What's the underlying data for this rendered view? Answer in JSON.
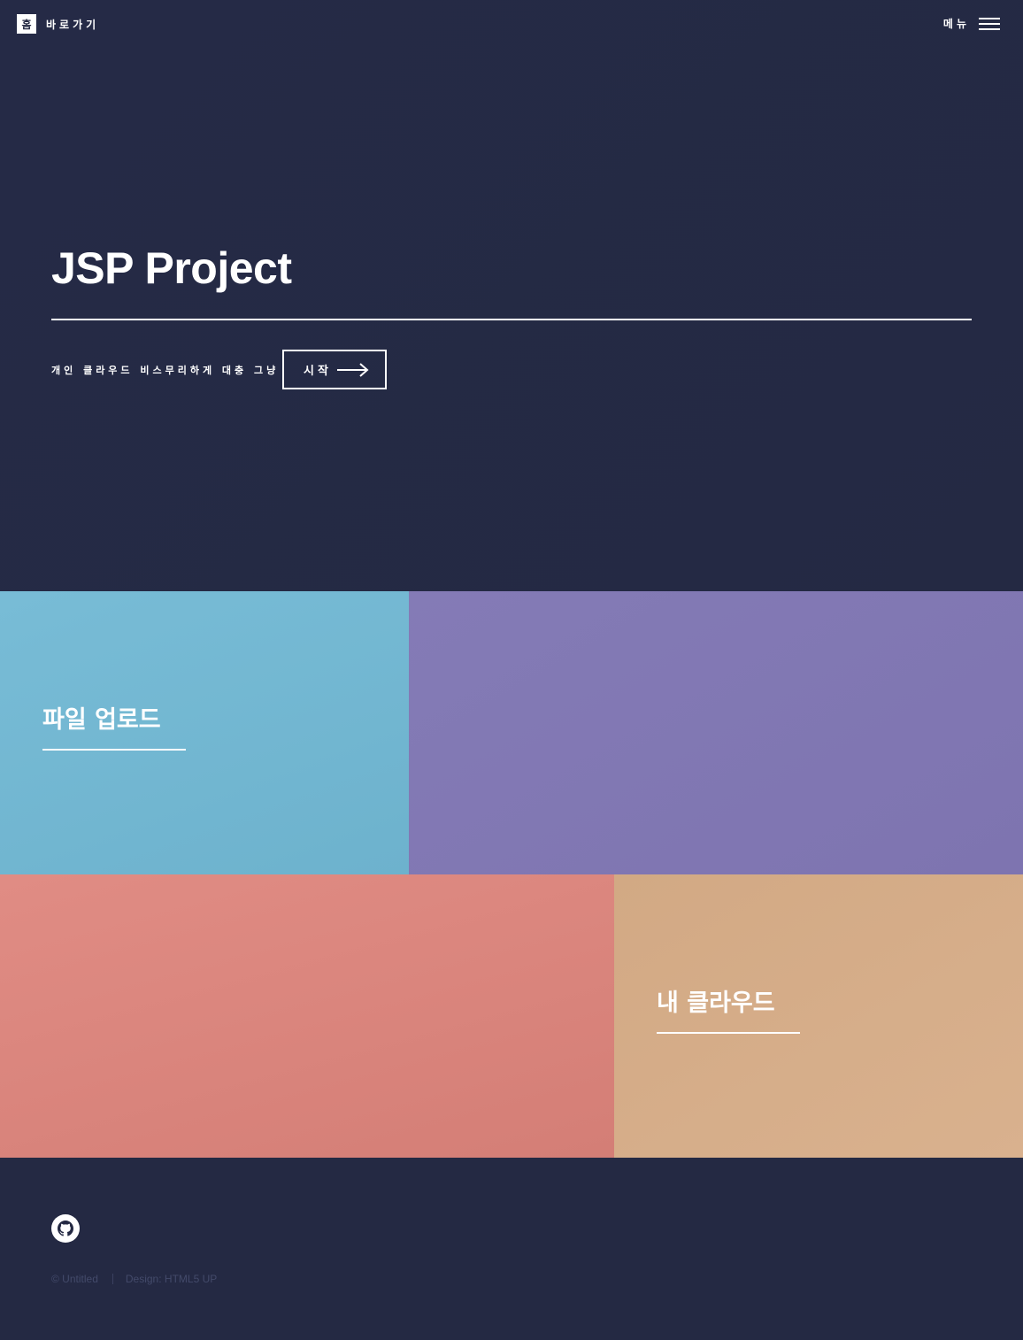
{
  "header": {
    "logo_mark": "홈",
    "logo_text": "바로가기",
    "menu_label": "메뉴"
  },
  "banner": {
    "title": "JSP Project",
    "subtitle": "개인 클라우드 비스무리하게 대충 그냥",
    "button_label": "시작"
  },
  "tiles": [
    {
      "title": "파일 업로드",
      "color": "#74b8d2"
    },
    {
      "title": "",
      "color": "#8279b4"
    },
    {
      "title": "",
      "color": "#da867e"
    },
    {
      "title": "내 클라우드",
      "color": "#d6ae8a"
    }
  ],
  "footer": {
    "icon": "github-icon",
    "copyright": "© Untitled",
    "design_credit": "Design: HTML5 UP"
  },
  "colors": {
    "background": "#242943",
    "text": "#ffffff"
  }
}
